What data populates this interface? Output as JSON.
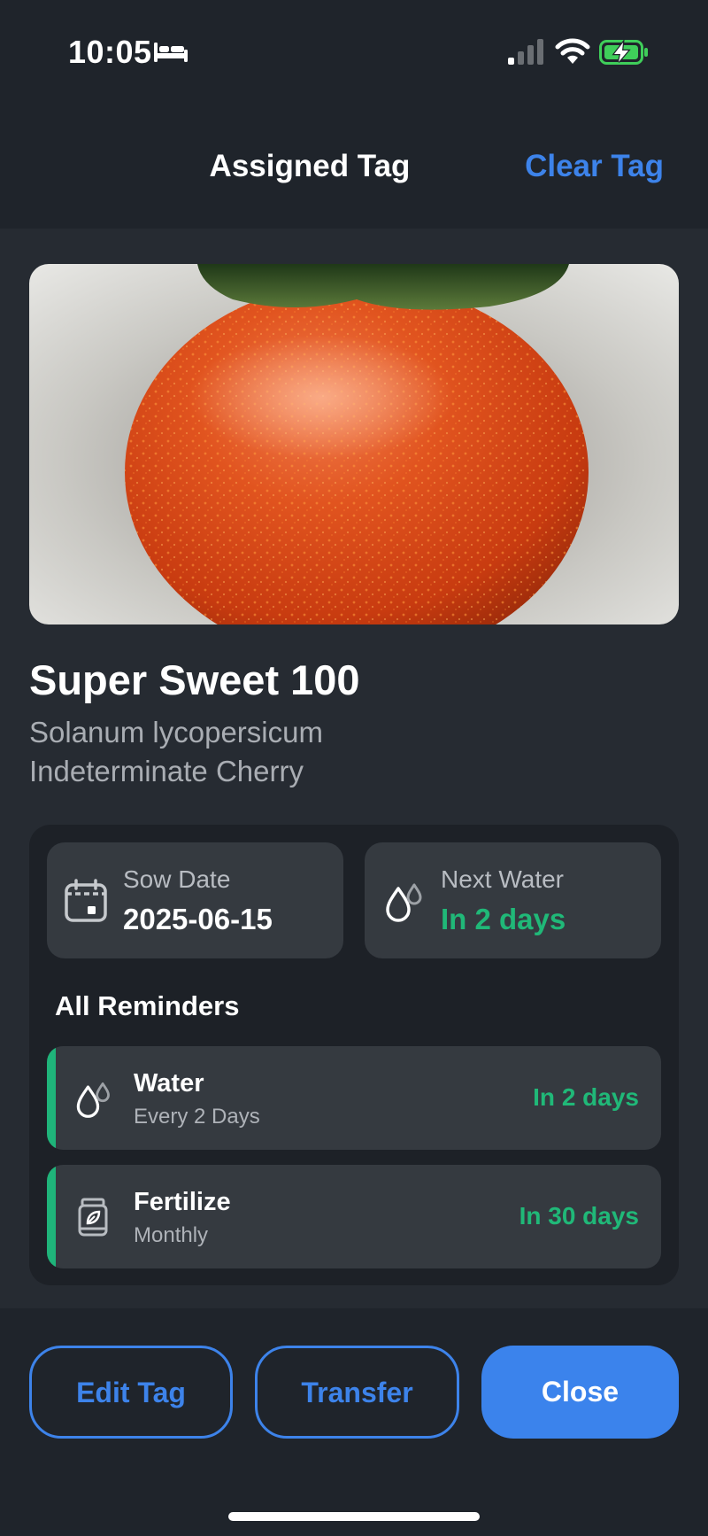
{
  "status_bar": {
    "time": "10:05",
    "icons": [
      "bed-icon",
      "cellular-signal-icon",
      "wifi-icon",
      "battery-charging-icon"
    ],
    "battery_color": "#3fce5a"
  },
  "nav": {
    "title": "Assigned Tag",
    "clear_label": "Clear Tag"
  },
  "plant": {
    "photo_subject": "tomato-photo",
    "name": "Super Sweet 100",
    "scientific_name": "Solanum lycopersicum",
    "type": "Indeterminate Cherry"
  },
  "info_cards": {
    "sow": {
      "label": "Sow Date",
      "value": "2025-06-15",
      "icon": "calendar-icon"
    },
    "next_water": {
      "label": "Next Water",
      "value": "In 2 days",
      "icon": "water-drops-icon"
    }
  },
  "reminders": {
    "title": "All Reminders",
    "items": [
      {
        "title": "Water",
        "subtitle": "Every 2 Days",
        "due": "In 2 days",
        "icon": "water-drops-icon"
      },
      {
        "title": "Fertilize",
        "subtitle": "Monthly",
        "due": "In 30 days",
        "icon": "fertilizer-icon"
      }
    ]
  },
  "actions": {
    "edit_label": "Edit Tag",
    "transfer_label": "Transfer",
    "close_label": "Close"
  },
  "colors": {
    "accent_blue": "#3d83ea",
    "status_green": "#20b878",
    "background": "#262b32"
  }
}
